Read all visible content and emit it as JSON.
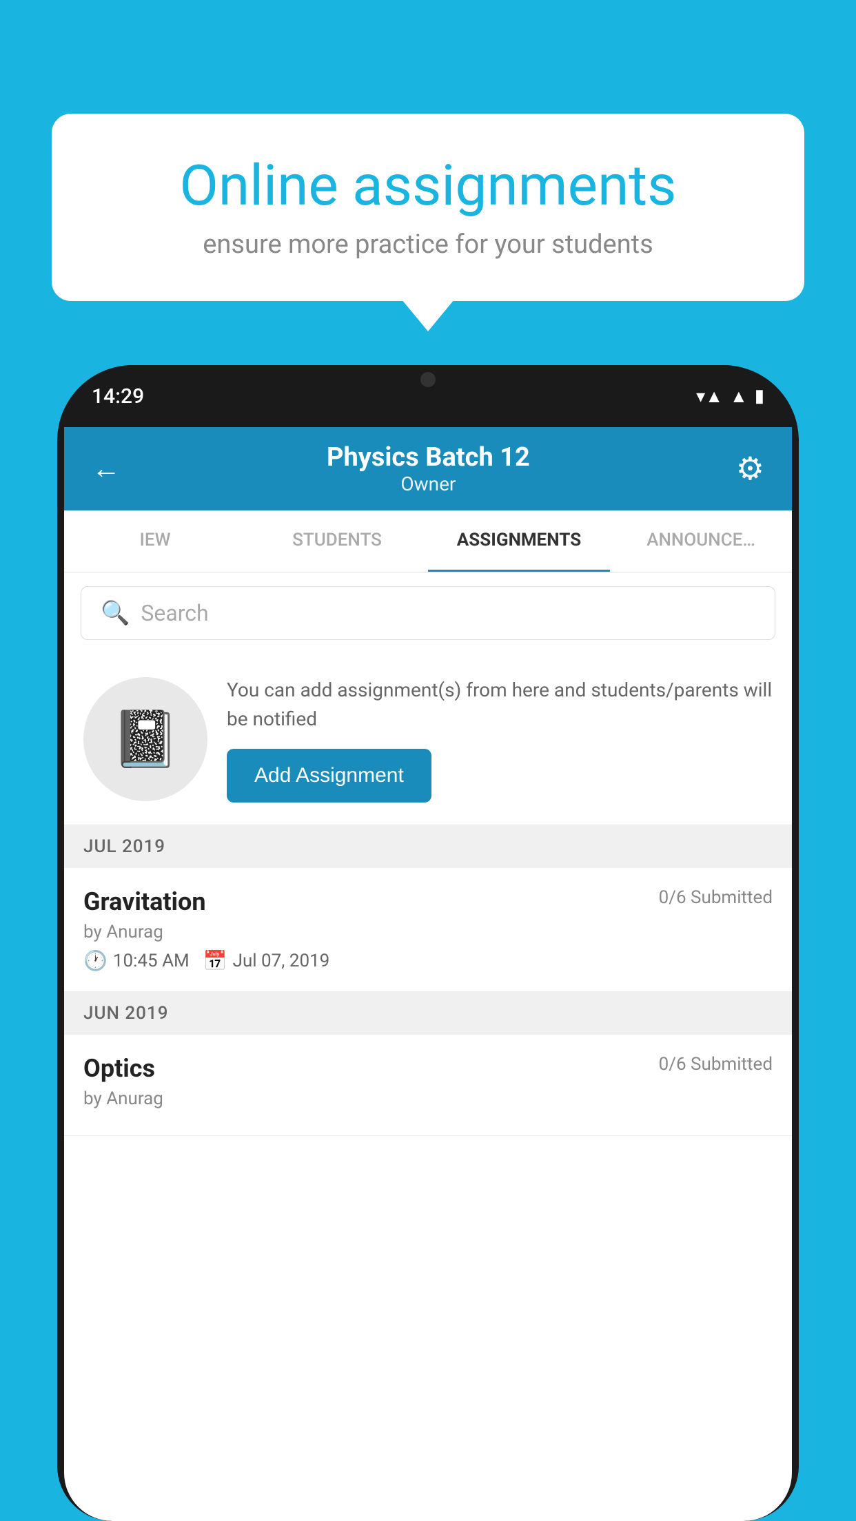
{
  "background_color": "#1ab4e0",
  "speech_bubble": {
    "title": "Online assignments",
    "subtitle": "ensure more practice for your students"
  },
  "phone": {
    "time": "14:29",
    "header": {
      "batch_name": "Physics Batch 12",
      "role": "Owner"
    },
    "tabs": [
      {
        "label": "IEW",
        "active": false
      },
      {
        "label": "STUDENTS",
        "active": false
      },
      {
        "label": "ASSIGNMENTS",
        "active": true
      },
      {
        "label": "ANNOUNCEMENTS",
        "active": false
      }
    ],
    "search": {
      "placeholder": "Search"
    },
    "promo": {
      "text": "You can add assignment(s) from here and students/parents will be notified",
      "button_label": "Add Assignment"
    },
    "sections": [
      {
        "month_label": "JUL 2019",
        "assignments": [
          {
            "title": "Gravitation",
            "submitted": "0/6 Submitted",
            "by": "by Anurag",
            "time": "10:45 AM",
            "date": "Jul 07, 2019"
          }
        ]
      },
      {
        "month_label": "JUN 2019",
        "assignments": [
          {
            "title": "Optics",
            "submitted": "0/6 Submitted",
            "by": "by Anurag",
            "time": "",
            "date": ""
          }
        ]
      }
    ]
  }
}
